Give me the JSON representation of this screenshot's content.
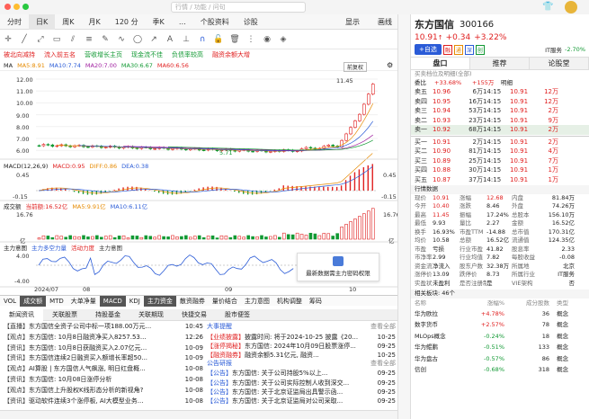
{
  "header": {
    "search_placeholder": "行情 / 功能 / 问句",
    "right_icons": [
      "shirt-icon",
      "avatar"
    ]
  },
  "periods": {
    "items": [
      "分时",
      "日K",
      "周K",
      "月K",
      "120 分",
      "季K",
      "…",
      "个股资料",
      "诊股"
    ],
    "active": 1,
    "display_label": "显示",
    "draw_label": "画线"
  },
  "tags": [
    {
      "t": "被北向减持",
      "c": "#e02020"
    },
    {
      "t": "流入前五名",
      "c": "#e02020"
    },
    {
      "t": "营收增长主页",
      "c": "#119933"
    },
    {
      "t": "现金流不佳",
      "c": "#119933"
    },
    {
      "t": "负债率较高",
      "c": "#119933"
    },
    {
      "t": "融资余额大增",
      "c": "#e02020"
    }
  ],
  "ma": {
    "label": "MA",
    "items": [
      {
        "t": "MA5:8.91",
        "c": "#e68a00"
      },
      {
        "t": "MA10:7.74",
        "c": "#2a5bd7"
      },
      {
        "t": "MA20:7.00",
        "c": "#a020a0"
      },
      {
        "t": "MA30:6.67",
        "c": "#119933"
      },
      {
        "t": "MA60:6.56",
        "c": "#e02020"
      }
    ],
    "fq": "前复权"
  },
  "kchart": {
    "y_ticks": [
      "12.00",
      "11.00",
      "10.00",
      "9.00",
      "8.00",
      "7.00",
      "6.00"
    ],
    "high_label": "11.45",
    "low_label": "5.71",
    "date_start": "2024/07",
    "date_mid": "08",
    "date_mid2": "09",
    "date_end": "10"
  },
  "macd": {
    "label": "MACD(12,26,9)",
    "items": [
      {
        "t": "MACD:0.95",
        "c": "#e02020"
      },
      {
        "t": "DIFF:0.86",
        "c": "#e68a00"
      },
      {
        "t": "DEA:0.38",
        "c": "#2a5bd7"
      }
    ],
    "y_top": "0.45",
    "y_bottom": "-0.15",
    "y_right_top": "0.45",
    "y_right_bottom": "-0.15"
  },
  "volume": {
    "label": "成交额",
    "items": [
      {
        "t": "当前额:16.52亿",
        "c": "#e02020"
      },
      {
        "t": "MA5:9.91亿",
        "c": "#e68a00"
      },
      {
        "t": "MA10:6.11亿",
        "c": "#2a5bd7"
      }
    ],
    "y_top": "16.76",
    "y_bottom": "亿",
    "y_right_top": "16.76",
    "y_right_bottom": "亿"
  },
  "mainforce": {
    "label": "主力意图",
    "items": [
      {
        "t": "主力多空力量",
        "c": "#2a5bd7"
      },
      {
        "t": "活动力度",
        "c": "#e02020"
      },
      {
        "t": "主力意图",
        "c": "#333"
      }
    ],
    "y_top": "4.00",
    "y_mid": "0.00",
    "y_bottom": "-4.00",
    "popup_text": "最新数据需主力密码权限"
  },
  "ind_tabs": {
    "items": [
      "VOL",
      "成交额",
      "MTD",
      "大单净量",
      "MACD",
      "KDJ",
      "主力资金",
      "散资融券",
      "量价结合",
      "主力意图",
      "机构调整",
      "筹码"
    ],
    "active": [
      1,
      4,
      6
    ]
  },
  "news": {
    "tabs": [
      "新闻资讯",
      "关联股票",
      "持股基金",
      "关联期现",
      "快捷交易",
      "股市便签"
    ],
    "more": "查看全部",
    "left": [
      {
        "tag": "直播",
        "title": "东方国信全资子公司中标一项188.00万元...",
        "time": "10:45"
      },
      {
        "tag": "观点",
        "title": "东方国信: 10月8日融资净买入8257.53...",
        "time": "12:26"
      },
      {
        "tag": "资讯",
        "title": "东方国信: 10月8日获融资买入2.07亿元...",
        "time": "10-09"
      },
      {
        "tag": "资讯",
        "title": "东方国信连续2日融资买入额增长率超50...",
        "time": "10-09"
      },
      {
        "tag": "观点",
        "title": "AI算股 | 东方国信人气飙涨, 明日红盘概...",
        "time": "10-08"
      },
      {
        "tag": "资讯",
        "title": "东方国信: 10月08日涨停分析",
        "time": "10-08"
      },
      {
        "tag": "观点",
        "title": "东方国信上升股权K线形态分析的新视角?",
        "time": "10-08"
      },
      {
        "tag": "资讯",
        "title": "驱动软件连续3个涨停板, AI大模型业务...",
        "time": "10-08"
      }
    ],
    "right_header": "大事提醒",
    "right_header2": "公告研报",
    "right": [
      {
        "tag": "业绩披露",
        "title": "披露时间: 将于2024-10-25 披露《20...",
        "time": "10-25",
        "c": "#e02020"
      },
      {
        "tag": "涨停揭秘",
        "title": "东方国信: 2024年10月09日股票涨停...",
        "time": "09-25",
        "c": "#e02020"
      },
      {
        "tag": "融资融券",
        "title": "融资余额5.31亿元, 融资...",
        "time": "10-25",
        "c": "#e02020"
      },
      {
        "tag": "公告",
        "title": "东方国信: 关于公司持股5%以上...",
        "time": "09-25",
        "c": "#2a5bd7"
      },
      {
        "tag": "公告",
        "title": "东方国信: 关于公司实际控制人收到深交...",
        "time": "09-25",
        "c": "#2a5bd7"
      },
      {
        "tag": "公告",
        "title": "东方国信: 关于北京证监局出具警示函...",
        "time": "09-25",
        "c": "#2a5bd7"
      },
      {
        "tag": "公告",
        "title": "东方国信: 关于北京证监局对公司采取...",
        "time": "09-25",
        "c": "#2a5bd7"
      }
    ]
  },
  "stock": {
    "name": "东方国信",
    "code": "300166",
    "price": "10.91",
    "change": "+0.34",
    "pct": "+3.22%",
    "add_label": "+自选",
    "badges": [
      "融",
      "通",
      "深",
      "创"
    ],
    "sector": "IT服务",
    "sector_pct": "-2.70%"
  },
  "rtabs": {
    "items": [
      "盘口",
      "推荐",
      "论股堂"
    ],
    "active": 0
  },
  "orderbook": {
    "tabs": [
      "买卖档位及明细",
      "(全部)"
    ],
    "ratio_label": "委比",
    "ratio": "+33.68%",
    "diff": "+155万",
    "detail_label": "明细",
    "asks": [
      {
        "l": "卖五",
        "p": "10.96",
        "v": "6万",
        "t": "14:15",
        "dp": "10.91",
        "dv": "12万"
      },
      {
        "l": "卖四",
        "p": "10.95",
        "v": "16万",
        "t": "14:15",
        "dp": "10.91",
        "dv": "12万"
      },
      {
        "l": "卖三",
        "p": "10.94",
        "v": "53万",
        "t": "14:15",
        "dp": "10.91",
        "dv": "2万"
      },
      {
        "l": "卖二",
        "p": "10.93",
        "v": "23万",
        "t": "14:15",
        "dp": "10.91",
        "dv": "9万"
      },
      {
        "l": "卖一",
        "p": "10.92",
        "v": "68万",
        "t": "14:15",
        "dp": "10.91",
        "dv": "2万"
      }
    ],
    "bids": [
      {
        "l": "买一",
        "p": "10.91",
        "v": "2万",
        "t": "14:15",
        "dp": "10.91",
        "dv": "2万"
      },
      {
        "l": "买二",
        "p": "10.90",
        "v": "81万",
        "t": "14:15",
        "dp": "10.91",
        "dv": "4万"
      },
      {
        "l": "买三",
        "p": "10.89",
        "v": "25万",
        "t": "14:15",
        "dp": "10.91",
        "dv": "7万"
      },
      {
        "l": "买四",
        "p": "10.88",
        "v": "30万",
        "t": "14:15",
        "dp": "10.91",
        "dv": "1万"
      },
      {
        "l": "买五",
        "p": "10.87",
        "v": "37万",
        "t": "14:15",
        "dp": "10.91",
        "dv": "1万"
      }
    ]
  },
  "quote": {
    "header": "行情数据",
    "rows": [
      [
        "现价",
        "10.91",
        "涨幅",
        "12.68",
        "内盘",
        "81.84万"
      ],
      [
        "今开",
        "10.40",
        "涨跌",
        "8.46",
        "外盘",
        "74.26万"
      ],
      [
        "最高",
        "11.45",
        "振幅",
        "17.24%",
        "总股本",
        "156.10万"
      ],
      [
        "最低",
        "9.93",
        "量比",
        "2.27",
        "金额",
        "16.52亿"
      ],
      [
        "换手",
        "16.93%",
        "市盈TTM",
        "-14.88",
        "总市值",
        "170.31亿"
      ],
      [
        "均价",
        "10.58",
        "总额",
        "16.52亿",
        "流通值",
        "124.35亿"
      ],
      [
        "市盈",
        "亏损",
        "行业市盈",
        "41.82",
        "股息率",
        "2.33"
      ],
      [
        "市净率",
        "2.99",
        "行业均值",
        "7.82",
        "每股收益",
        "-0.08"
      ],
      [
        "资金流向",
        "净流入",
        "股东户数",
        "32.38万",
        "所属地",
        "北京"
      ],
      [
        "涨停价",
        "13.09",
        "跌停价",
        "8.73",
        "所属行业",
        "IT服务"
      ],
      [
        "实盈状态",
        "未盈利",
        "是否注册制",
        "是",
        "VIE架构",
        "否"
      ]
    ]
  },
  "concepts": {
    "header": "相关板块: 46个",
    "cols": [
      "名称",
      "涨幅%",
      "成分股数",
      "类型"
    ],
    "rows": [
      {
        "n": "华为欧拉",
        "p": "+4.78%",
        "c": "36",
        "t": "概念"
      },
      {
        "n": "数字货币",
        "p": "+2.57%",
        "c": "78",
        "t": "概念"
      },
      {
        "n": "MLOps概念",
        "p": "-0.24%",
        "c": "18",
        "t": "概念"
      },
      {
        "n": "华为鲲鹏",
        "p": "-0.51%",
        "c": "133",
        "t": "概念"
      },
      {
        "n": "华为盘古",
        "p": "-0.57%",
        "c": "86",
        "t": "概念"
      },
      {
        "n": "信创",
        "p": "-0.68%",
        "c": "318",
        "t": "概念"
      }
    ]
  },
  "colors": {
    "up": "#e02020",
    "down": "#119933",
    "accent": "#2a5bd7",
    "macd_dif": "#e68a00",
    "macd_dea": "#2a5bd7"
  },
  "kline_data": []
}
